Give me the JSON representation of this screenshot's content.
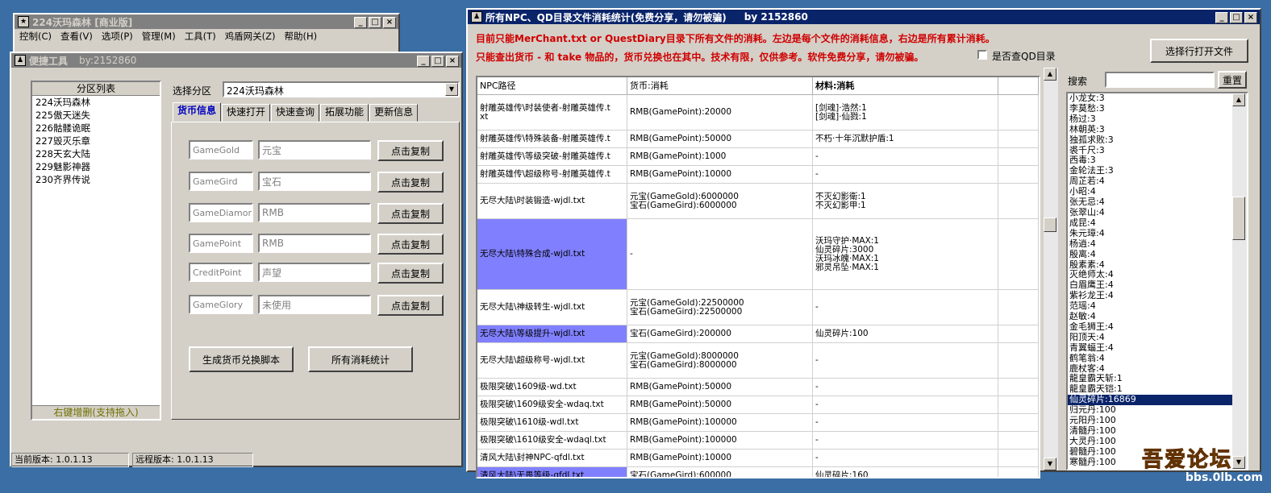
{
  "bg_window": {
    "title": "224沃玛森林 [商业版]",
    "menu": [
      "控制(C)",
      "查看(V)",
      "选项(P)",
      "管理(M)",
      "工具(T)",
      "鸡盾网关(Z)",
      "帮助(H)"
    ]
  },
  "tool_window": {
    "title": "便捷工具",
    "by": "by:2152860",
    "list_header": "分区列表",
    "list_items": [
      "224沃玛森林",
      "225傲天迷失",
      "226骷髅诡眠",
      "227毁灭乐章",
      "228天玄大陆",
      "229魅影神器",
      "230齐界传说"
    ],
    "list_footer": "右键增删(支持拖入)",
    "select_label": "选择分区",
    "select_value": "224沃玛森林",
    "tabs": [
      "货币信息",
      "快速打开",
      "快速查询",
      "拓展功能",
      "更新信息"
    ],
    "rows": [
      {
        "key": "GameGold",
        "name": "元宝",
        "btn": "点击复制"
      },
      {
        "key": "GameGird",
        "name": "宝石",
        "btn": "点击复制"
      },
      {
        "key": "GameDiamond",
        "name": "RMB",
        "btn": "点击复制"
      },
      {
        "key": "GamePoint",
        "name": "RMB",
        "btn": "点击复制"
      },
      {
        "key": "CreditPoint",
        "name": "声望",
        "btn": "点击复制"
      },
      {
        "key": "GameGlory",
        "name": "未使用",
        "btn": "点击复制"
      }
    ],
    "gen_button": "生成货币兑换脚本",
    "stats_button": "所有消耗统计",
    "status_current": "当前版本: 1.0.1.13",
    "status_remote": "远程版本: 1.0.1.13"
  },
  "stats_window": {
    "title": "所有NPC、QD目录文件消耗统计(免费分享，请勿被骗)",
    "by": "by 2152860",
    "note1": "目前只能MerChant.txt or QuestDiary目录下所有文件的消耗。左边是每个文件的消耗信息，右边是所有累计消耗。",
    "note2": "只能查出货币 - 和 take 物品的，货币兑换也在其中。技术有限，仅供参考。软件免费分享，请勿被骗。",
    "checkbox_label": "是否查QD目录",
    "open_button": "选择行打开文件",
    "search_label": "搜索",
    "search_value": "",
    "reset_button": "重置",
    "columns": [
      "NPC路径",
      "货币:消耗",
      "材料:消耗",
      ""
    ],
    "rows": [
      {
        "path": "射雕英雄传\\时装使者-射雕英雄传.t\nxt",
        "cur": "RMB(GamePoint):20000",
        "mat": "[剑魂]·浩然:1\n[剑魂]·仙戮:1",
        "h": 44
      },
      {
        "path": "射雕英雄传\\特殊装备-射雕英雄传.t",
        "cur": "RMB(GamePoint):50000",
        "mat": "不朽·十年沉默护盾:1",
        "h": 22
      },
      {
        "path": "射雕英雄传\\等级突破-射雕英雄传.t",
        "cur": "RMB(GamePoint):1000",
        "mat": "-",
        "h": 22
      },
      {
        "path": "射雕英雄传\\超级称号-射雕英雄传.t",
        "cur": "RMB(GamePoint):10000",
        "mat": "-",
        "h": 22
      },
      {
        "path": "无尽大陆\\时装锻造-wjdl.txt",
        "cur": "元宝(GameGold):6000000\n宝石(GameGird):6000000",
        "mat": "不灭幻影衛:1\n不灭幻影甲:1",
        "h": 44
      },
      {
        "path": "无尽大陆\\特殊合成-wjdl.txt",
        "cur": "-",
        "mat": "沃玛守护·MAX:1\n仙灵碎片:3000\n沃玛冰魄·MAX:1\n邪灵吊坠·MAX:1",
        "h": 88,
        "sel": true
      },
      {
        "path": "无尽大陆\\神级转生-wjdl.txt",
        "cur": "元宝(GameGold):22500000\n宝石(GameGird):22500000",
        "mat": "-",
        "h": 44
      },
      {
        "path": "无尽大陆\\等级提升-wjdl.txt",
        "cur": "宝石(GameGird):200000",
        "mat": "仙灵碎片:100",
        "h": 22,
        "sel": true
      },
      {
        "path": "无尽大陆\\超级称号-wjdl.txt",
        "cur": "元宝(GameGold):8000000\n宝石(GameGird):8000000",
        "mat": "-",
        "h": 44
      },
      {
        "path": "极限突破\\1609级-wd.txt",
        "cur": "RMB(GamePoint):50000",
        "mat": "-",
        "h": 22
      },
      {
        "path": "极限突破\\1609级安全-wdaq.txt",
        "cur": "RMB(GamePoint):50000",
        "mat": "-",
        "h": 22
      },
      {
        "path": "极限突破\\1610级-wdl.txt",
        "cur": "RMB(GamePoint):100000",
        "mat": "-",
        "h": 22
      },
      {
        "path": "极限突破\\1610级安全-wdaql.txt",
        "cur": "RMB(GamePoint):100000",
        "mat": "-",
        "h": 22
      },
      {
        "path": "清风大陆\\封神NPC-qfdl.txt",
        "cur": "RMB(GamePoint):10000",
        "mat": "-",
        "h": 22
      },
      {
        "path": "清风大陆\\无畏等级-qfdl.txt",
        "cur": "宝石(GameGird):600000",
        "mat": "仙灵碎片:160",
        "h": 22,
        "sel": true
      }
    ],
    "summary": [
      "小龙女:3",
      "李莫愁:3",
      "杨过:3",
      "林朝英:3",
      "独孤求败:3",
      "裘千尺:3",
      "西毒:3",
      "金轮法王:3",
      "周芷若:4",
      "小昭:4",
      "张无忌:4",
      "张翠山:4",
      "成昆:4",
      "朱元璋:4",
      "杨逍:4",
      "殷离:4",
      "殷素素:4",
      "灭绝师太:4",
      "白眉鹰王:4",
      "紫衫龙王:4",
      "范瑶:4",
      "赵敏:4",
      "金毛狮王:4",
      "阳顶天:4",
      "青翼蝠王:4",
      "鹤笔翁:4",
      "鹿杖客:4",
      "龍皇霸天斩:1",
      "龍皇霸天铠:1",
      "仙灵碎片:16869",
      "归元丹:100",
      "元阳丹:100",
      "清髓丹:100",
      "大灵丹:100",
      "碧髓丹:100",
      "寒髓丹:100"
    ],
    "summary_selected": "仙灵碎片:16869"
  },
  "watermark": {
    "text": "吾爱论坛",
    "url": "bbs.0lb.com"
  }
}
